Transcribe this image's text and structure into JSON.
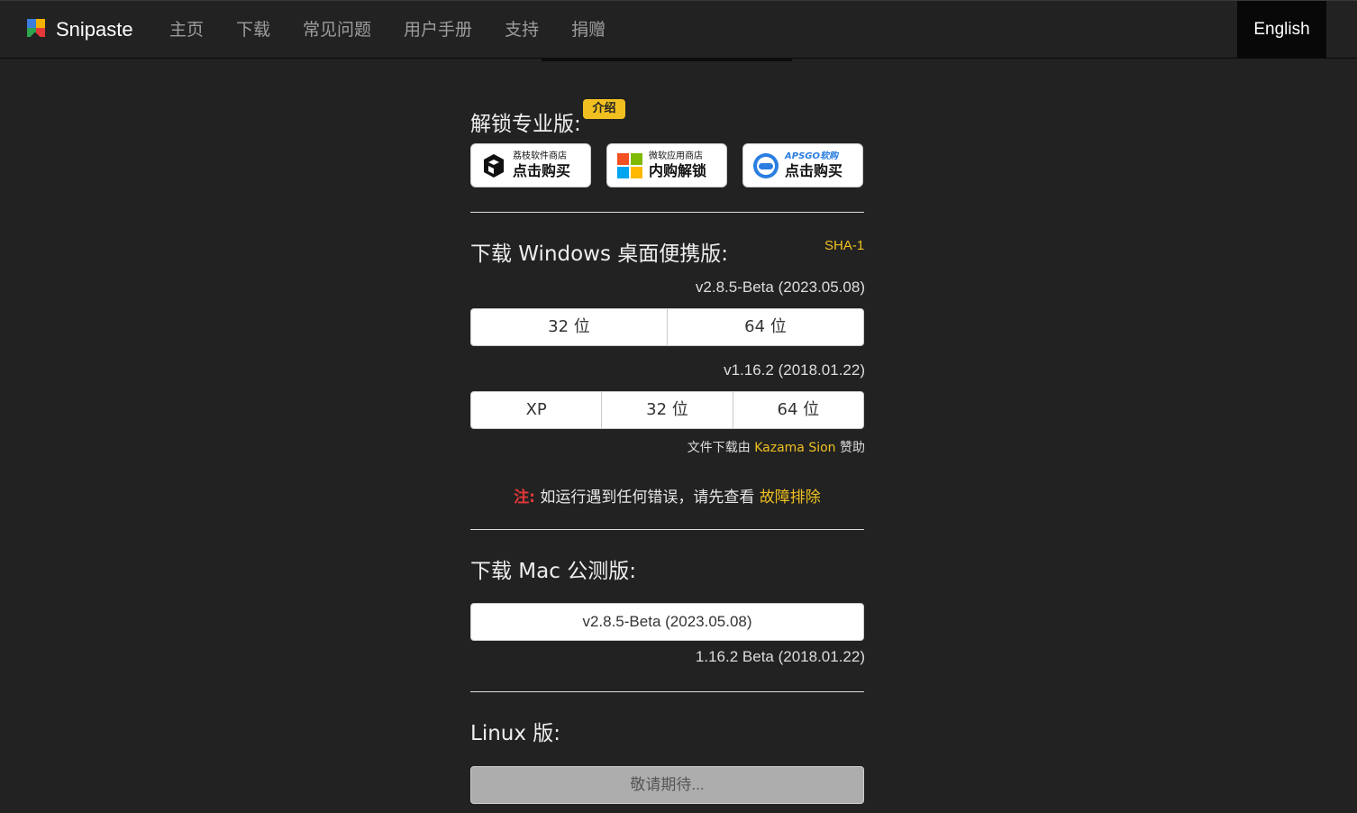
{
  "brand": {
    "name": "Snipaste"
  },
  "nav": {
    "items": [
      "主页",
      "下载",
      "常见问题",
      "用户手册",
      "支持",
      "捐赠"
    ],
    "language": "English"
  },
  "pro": {
    "title": "解锁专业版:",
    "badge": "介绍",
    "stores": [
      {
        "icon": "lizhi-store-icon",
        "small": "荔枝软件商店",
        "big": "点击购买"
      },
      {
        "icon": "microsoft-store-icon",
        "small": "微软应用商店",
        "big": "内购解锁"
      },
      {
        "icon": "apsgo-icon",
        "small": "APSGO软购",
        "big": "点击购买"
      }
    ]
  },
  "windows": {
    "title": "下载 Windows 桌面便携版:",
    "hash_link": "SHA-1",
    "latest_version": "v2.8.5-Beta (2023.05.08)",
    "latest_buttons": [
      "32 位",
      "64 位"
    ],
    "legacy_version": "v1.16.2 (2018.01.22)",
    "legacy_buttons": [
      "XP",
      "32 位",
      "64 位"
    ],
    "sponsor_prefix": "文件下载由",
    "sponsor_name": "Kazama Sion",
    "sponsor_suffix": "赞助"
  },
  "note": {
    "label": "注:",
    "text": "如运行遇到任何错误，请先查看",
    "link": "故障排除"
  },
  "mac": {
    "title": "下载 Mac 公测版:",
    "latest_button": "v2.8.5-Beta (2023.05.08)",
    "legacy_version": "1.16.2 Beta (2018.01.22)"
  },
  "linux": {
    "title": "Linux 版:",
    "button": "敬请期待..."
  },
  "colors": {
    "accent": "#f0c020",
    "warning": "#e5383b",
    "background": "#222222"
  }
}
